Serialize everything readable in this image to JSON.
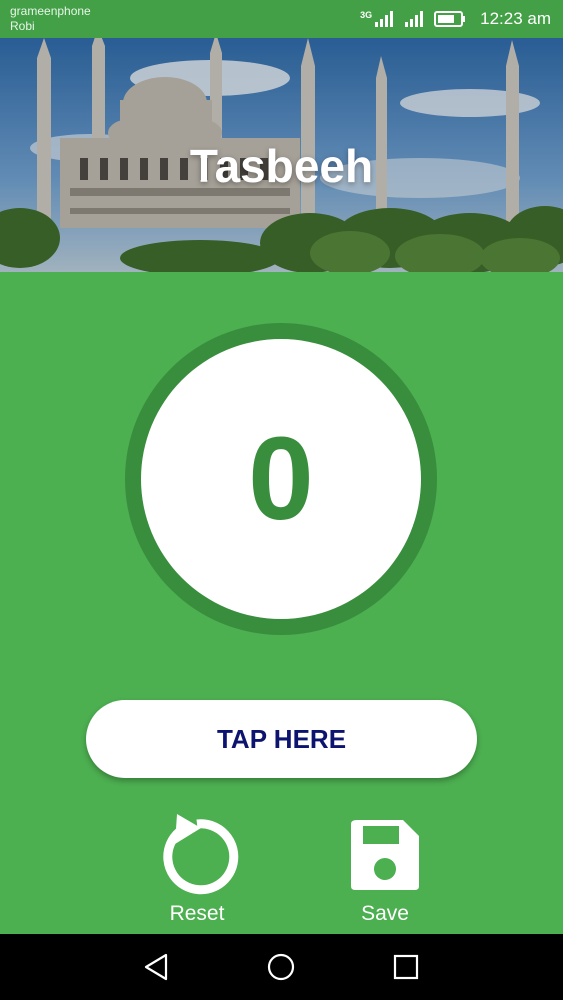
{
  "status_bar": {
    "carrier_1": "grameenphone",
    "carrier_2": "Robi",
    "network_type": "3G",
    "time": "12:23 am",
    "icons": [
      "signal-icon",
      "signal-icon",
      "battery-icon"
    ]
  },
  "header": {
    "title": "Tasbeeh",
    "image": "mosque-banner"
  },
  "counter": {
    "value": "0"
  },
  "tap_button": {
    "label": "TAP HERE"
  },
  "actions": {
    "reset_label": "Reset",
    "save_label": "Save"
  },
  "nav": {
    "icons": [
      "back-icon",
      "home-icon",
      "recents-icon"
    ]
  },
  "colors": {
    "background": "#4caf50",
    "status_bar": "#43a047",
    "ring": "#388e3c",
    "tap_text": "#0d1470"
  }
}
